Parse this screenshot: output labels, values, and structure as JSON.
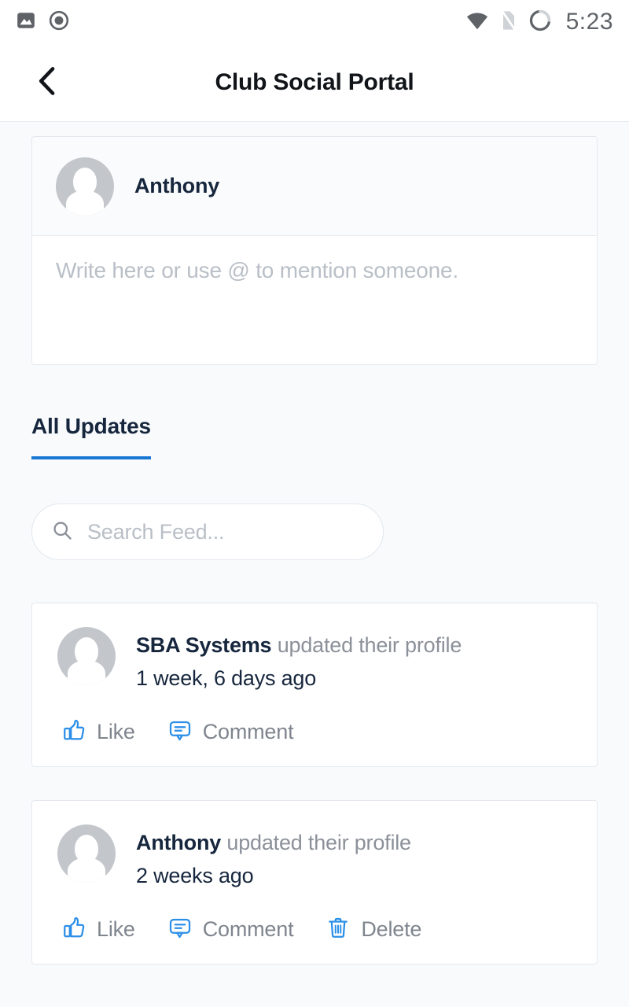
{
  "status_bar": {
    "time": "5:23",
    "left_icons": [
      "image-icon",
      "screen-record-icon"
    ],
    "right_icons": [
      "wifi-icon",
      "sim-off-icon",
      "battery-circle-icon"
    ]
  },
  "header": {
    "title": "Club Social Portal",
    "back_icon": "back-chevron-icon"
  },
  "composer": {
    "author": "Anthony",
    "avatar": "user-avatar",
    "placeholder": "Write here or use @ to mention someone."
  },
  "tabs": [
    {
      "label": "All Updates",
      "active": true
    }
  ],
  "search": {
    "placeholder": "Search Feed...",
    "icon": "search-icon"
  },
  "feed": {
    "posts": [
      {
        "actor": "SBA Systems",
        "action": "updated their profile",
        "time": "1 week, 6 days ago",
        "actions": [
          {
            "label": "Like",
            "icon": "thumbs-up-icon"
          },
          {
            "label": "Comment",
            "icon": "comment-bubble-icon"
          }
        ]
      },
      {
        "actor": "Anthony",
        "action": "updated their profile",
        "time": "2 weeks ago",
        "actions": [
          {
            "label": "Like",
            "icon": "thumbs-up-icon"
          },
          {
            "label": "Comment",
            "icon": "comment-bubble-icon"
          },
          {
            "label": "Delete",
            "icon": "trash-icon"
          }
        ]
      }
    ]
  },
  "colors": {
    "accent_blue": "#1877d2",
    "icon_blue": "#2b8fe8",
    "text_dark": "#16263d",
    "text_muted": "#8b9099",
    "placeholder": "#b9bfc7",
    "page_bg": "#f8fafc",
    "card_bg": "#ffffff",
    "border": "#e4e8ee"
  }
}
